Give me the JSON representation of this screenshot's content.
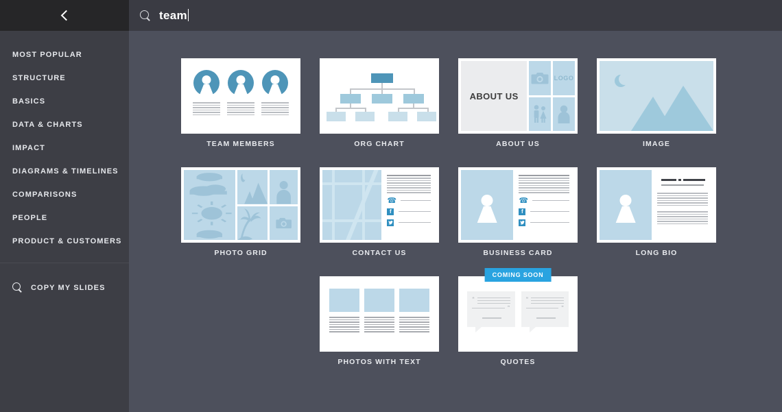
{
  "sidebar": {
    "back_icon": "chevron-left-icon",
    "items": [
      {
        "label": "MOST POPULAR"
      },
      {
        "label": "STRUCTURE"
      },
      {
        "label": "BASICS"
      },
      {
        "label": "DATA & CHARTS"
      },
      {
        "label": "IMPACT"
      },
      {
        "label": "DIAGRAMS & TIMELINES"
      },
      {
        "label": "COMPARISONS"
      },
      {
        "label": "PEOPLE"
      },
      {
        "label": "PRODUCT & CUSTOMERS"
      }
    ],
    "copy_slides": {
      "label": "COPY MY SLIDES",
      "icon": "search-icon"
    }
  },
  "topbar": {
    "search_icon": "search-icon",
    "search_value": "team",
    "search_placeholder": "Search templates"
  },
  "cards": [
    {
      "label": "TEAM MEMBERS",
      "type": "team-members"
    },
    {
      "label": "ORG CHART",
      "type": "org-chart"
    },
    {
      "label": "ABOUT US",
      "type": "about-us",
      "panel_text": "ABOUT US",
      "logo_text": "LOGO"
    },
    {
      "label": "IMAGE",
      "type": "image"
    },
    {
      "label": "PHOTO GRID",
      "type": "photo-grid"
    },
    {
      "label": "CONTACT US",
      "type": "contact-us"
    },
    {
      "label": "BUSINESS CARD",
      "type": "business-card"
    },
    {
      "label": "LONG BIO",
      "type": "long-bio"
    },
    {
      "label": "PHOTOS WITH TEXT",
      "type": "photos-with-text"
    },
    {
      "label": "QUOTES",
      "type": "quotes",
      "badge": "COMING SOON"
    }
  ],
  "colors": {
    "sidebar_bg": "#3d3e45",
    "sidebar_top_bg": "#262628",
    "topbar_bg": "#3a3b43",
    "content_bg": "#4d505c",
    "badge_blue": "#29a3e0",
    "accent_blue": "#4e95b8",
    "light_blue": "#c9dfea",
    "mid_blue": "#9ec9dc"
  }
}
